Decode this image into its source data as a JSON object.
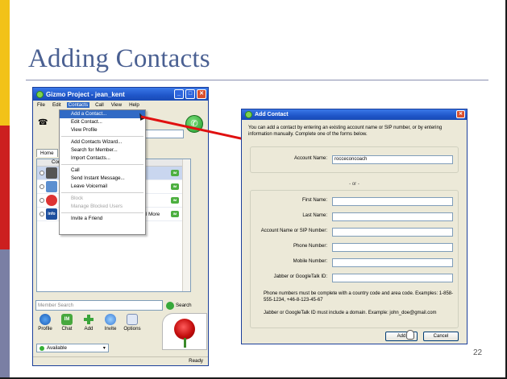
{
  "slide": {
    "title": "Adding Contacts",
    "number": "22",
    "colors": {
      "title": "#4a6092",
      "bar_top": "#f2c218",
      "bar_mid": "#cc1f1f",
      "bar_bot": "#7a7fa4",
      "arrow": "#e01010"
    }
  },
  "gizmo": {
    "window_title": "Gizmo Project - jean_kent",
    "menu": [
      "File",
      "Edit",
      "Contacts",
      "Call",
      "View",
      "Help"
    ],
    "tabs": [
      "Home",
      "C"
    ],
    "column_header": "Con",
    "contact_extra_text": "l More",
    "member_search_placeholder": "Member Search",
    "search_label": "Search",
    "toolbar": [
      "Profile",
      "Chat",
      "Add",
      "Invite",
      "Options"
    ],
    "status": "Available",
    "statusbar": "Ready"
  },
  "contacts_menu": {
    "items": [
      {
        "label": "Add a Contact...",
        "state": "highlighted"
      },
      {
        "label": "Edit Contact...",
        "state": "normal"
      },
      {
        "label": "View Profile",
        "state": "normal"
      },
      {
        "sep": true
      },
      {
        "label": "Add Contacts Wizard...",
        "state": "normal"
      },
      {
        "label": "Search for Member...",
        "state": "normal"
      },
      {
        "label": "Import Contacts...",
        "state": "normal"
      },
      {
        "sep": true
      },
      {
        "label": "Call",
        "state": "normal"
      },
      {
        "label": "Send Instant Message...",
        "state": "normal"
      },
      {
        "label": "Leave Voicemail",
        "state": "normal"
      },
      {
        "sep": true
      },
      {
        "label": "Block",
        "state": "disabled"
      },
      {
        "label": "Manage Blocked Users",
        "state": "disabled"
      },
      {
        "sep": true
      },
      {
        "label": "Invite a Friend",
        "state": "normal"
      }
    ]
  },
  "dialog": {
    "title": "Add Contact",
    "intro": "You can add a contact by entering an existing account name or SIP number, or by entering information manually. Complete one of the forms below.",
    "account_name_label": "Account Name:",
    "account_name_value": "rocceconcoach",
    "or_text": "- or -",
    "fields": [
      "First Name:",
      "Last Name:",
      "Account Name or SIP Number:",
      "Phone Number:",
      "Mobile Number:",
      "Jabber or GoogleTalk ID:"
    ],
    "note1": "Phone numbers must be complete with a country code and area code. Examples: 1-858-555-1234, +46-8-123-45-67",
    "note2": "Jabber or GoogleTalk ID must include a domain.  Example: john_doe@gmail.com",
    "add_button": "Add",
    "cancel_button": "Cancel"
  }
}
